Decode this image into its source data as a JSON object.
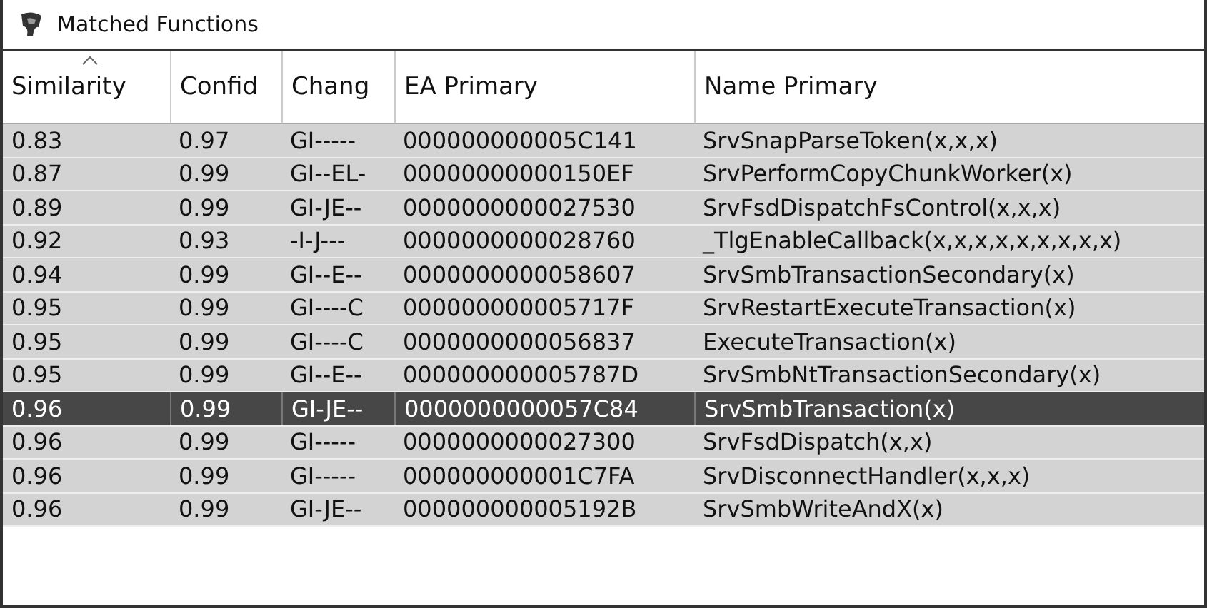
{
  "window": {
    "title": "Matched Functions"
  },
  "table": {
    "columns": [
      {
        "label": "Similarity",
        "sorted": true
      },
      {
        "label": "Confid",
        "sorted": false
      },
      {
        "label": "Chang",
        "sorted": false
      },
      {
        "label": "EA Primary",
        "sorted": false
      },
      {
        "label": "Name Primary",
        "sorted": false
      }
    ],
    "rows": [
      {
        "selected": false,
        "cells": [
          "0.83",
          "0.97",
          "GI-----",
          "000000000005C141",
          "SrvSnapParseToken(x,x,x)"
        ]
      },
      {
        "selected": false,
        "cells": [
          "0.87",
          "0.99",
          "GI--EL-",
          "00000000000150EF",
          "SrvPerformCopyChunkWorker(x)"
        ]
      },
      {
        "selected": false,
        "cells": [
          "0.89",
          "0.99",
          "GI-JE--",
          "0000000000027530",
          "SrvFsdDispatchFsControl(x,x,x)"
        ]
      },
      {
        "selected": false,
        "cells": [
          "0.92",
          "0.93",
          "-I-J---",
          "0000000000028760",
          "_TlgEnableCallback(x,x,x,x,x,x,x,x,x)"
        ]
      },
      {
        "selected": false,
        "cells": [
          "0.94",
          "0.99",
          "GI--E--",
          "0000000000058607",
          "SrvSmbTransactionSecondary(x)"
        ]
      },
      {
        "selected": false,
        "cells": [
          "0.95",
          "0.99",
          "GI----C",
          "000000000005717F",
          "SrvRestartExecuteTransaction(x)"
        ]
      },
      {
        "selected": false,
        "cells": [
          "0.95",
          "0.99",
          "GI----C",
          "0000000000056837",
          "ExecuteTransaction(x)"
        ]
      },
      {
        "selected": false,
        "cells": [
          "0.95",
          "0.99",
          "GI--E--",
          "000000000005787D",
          "SrvSmbNtTransactionSecondary(x)"
        ]
      },
      {
        "selected": true,
        "cells": [
          "0.96",
          "0.99",
          "GI-JE--",
          "0000000000057C84",
          "SrvSmbTransaction(x)"
        ]
      },
      {
        "selected": false,
        "cells": [
          "0.96",
          "0.99",
          "GI-----",
          "0000000000027300",
          "SrvFsdDispatch(x,x)"
        ]
      },
      {
        "selected": false,
        "cells": [
          "0.96",
          "0.99",
          "GI-----",
          "000000000001C7FA",
          "SrvDisconnectHandler(x,x,x)"
        ]
      },
      {
        "selected": false,
        "cells": [
          "0.96",
          "0.99",
          "GI-JE--",
          "000000000005192B",
          "SrvSmbWriteAndX(x)"
        ]
      }
    ]
  }
}
